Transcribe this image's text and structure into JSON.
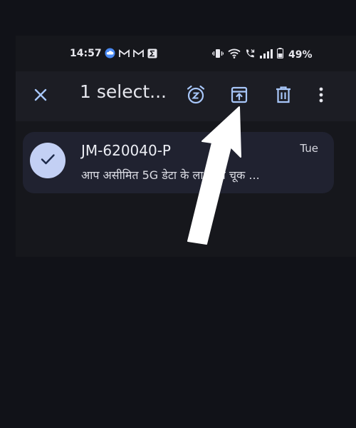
{
  "status_bar": {
    "time": "14:57",
    "battery": "49%",
    "left_icons": [
      "cloud-icon",
      "gmail-icon",
      "gmail-icon",
      "sum-icon"
    ],
    "right_icons": [
      "vibrate-icon",
      "wifi-icon",
      "call-icon",
      "signal-icon",
      "battery-icon"
    ]
  },
  "action_bar": {
    "title": "1 select...",
    "actions": [
      "close-icon",
      "snooze-icon",
      "archive-icon",
      "delete-icon",
      "more-vert-icon"
    ]
  },
  "email": {
    "sender": "JM-620040-P",
    "date": "Tue",
    "subject": "आप असीमित 5G डेटा के लाभों से चूक ..."
  },
  "colors": {
    "background": "#111218",
    "action_bar": "#1c1d24",
    "card": "#202230",
    "accent": "#a8c7fa",
    "check_circle": "#c3d0f4"
  }
}
